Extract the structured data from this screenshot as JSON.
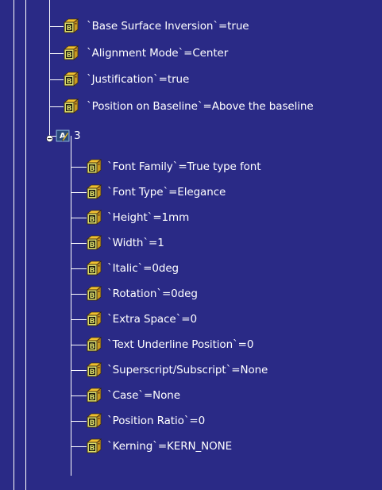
{
  "tree": {
    "top_parameters": [
      {
        "label": "`Base Surface Inversion`=true"
      },
      {
        "label": "`Alignment Mode`=Center"
      },
      {
        "label": "`Justification`=true"
      },
      {
        "label": "`Position on Baseline`=Above the baseline"
      }
    ],
    "text_node": {
      "label": "3",
      "icon": "text-node-icon",
      "expanded": true
    },
    "child_parameters": [
      {
        "label": "`Font Family`=True type font"
      },
      {
        "label": "`Font Type`=Elegance"
      },
      {
        "label": "`Height`=1mm"
      },
      {
        "label": "`Width`=1"
      },
      {
        "label": "`Italic`=0deg"
      },
      {
        "label": "`Rotation`=0deg"
      },
      {
        "label": "`Extra Space`=0"
      },
      {
        "label": "`Text Underline Position`=0"
      },
      {
        "label": "`Superscript/Subscript`=None"
      },
      {
        "label": "`Case`=None"
      },
      {
        "label": "`Position Ratio`=0"
      },
      {
        "label": "`Kerning`=KERN_NONE"
      }
    ]
  },
  "colors": {
    "background": "#2a2a86",
    "text": "#ffffff",
    "icon_body": "#f0c030",
    "icon_face": "#dcdc6a",
    "icon_dark": "#3a2a10"
  }
}
